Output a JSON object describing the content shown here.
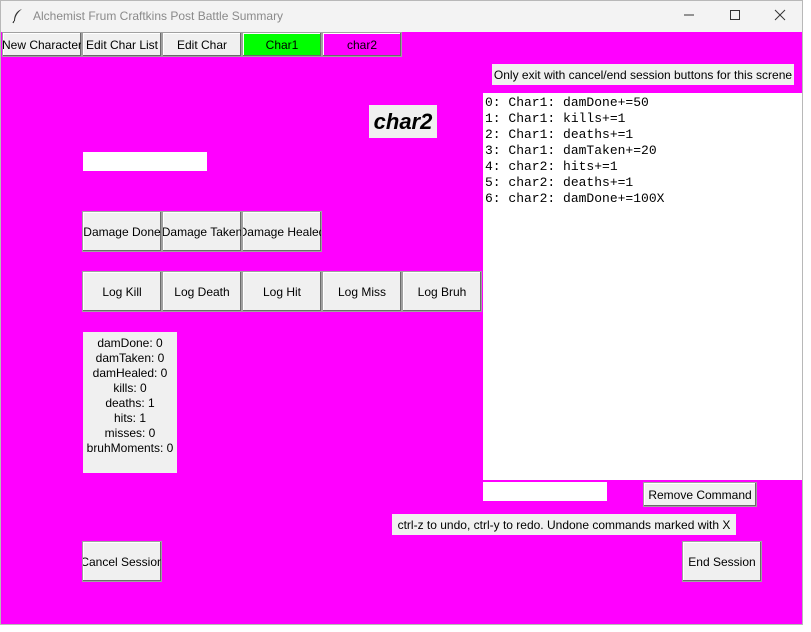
{
  "window": {
    "title": "Alchemist Frum Craftkins Post Battle Summary"
  },
  "toolbar": {
    "new_character": "New Character",
    "edit_char_list": "Edit Char List",
    "edit_char": "Edit Char",
    "char_tabs": [
      {
        "label": "Char1",
        "color": "#00ff00"
      },
      {
        "label": "char2",
        "color": "#ff00ff"
      }
    ]
  },
  "notice": "Only exit with cancel/end session buttons for this screne",
  "selected_char": "char2",
  "name_input": {
    "value": ""
  },
  "heal_buttons": [
    "Damage Done",
    "Damage Taken",
    "Damage Healed"
  ],
  "log_buttons": [
    "Log Kill",
    "Log Death",
    "Log Hit",
    "Log Miss",
    "Log Bruh"
  ],
  "stats": [
    "damDone: 0",
    "damTaken: 0",
    "damHealed: 0",
    "kills: 0",
    "deaths: 1",
    "hits: 1",
    "misses: 0",
    "bruhMoments: 0"
  ],
  "command_log": [
    "0: Char1: damDone+=50",
    "1: Char1: kills+=1",
    "2: Char1: deaths+=1",
    "3: Char1: damTaken+=20",
    "4: char2: hits+=1",
    "5: char2: deaths+=1",
    "6: char2: damDone+=100X"
  ],
  "remove_input": {
    "value": ""
  },
  "remove_command": "Remove Command",
  "undo_hint": "ctrl-z to undo, ctrl-y to redo. Undone commands marked with X",
  "cancel_session": "Cancel Session",
  "end_session": "End Session",
  "colors": {
    "background": "#ff00ff",
    "active_tab": "#00ff00"
  }
}
